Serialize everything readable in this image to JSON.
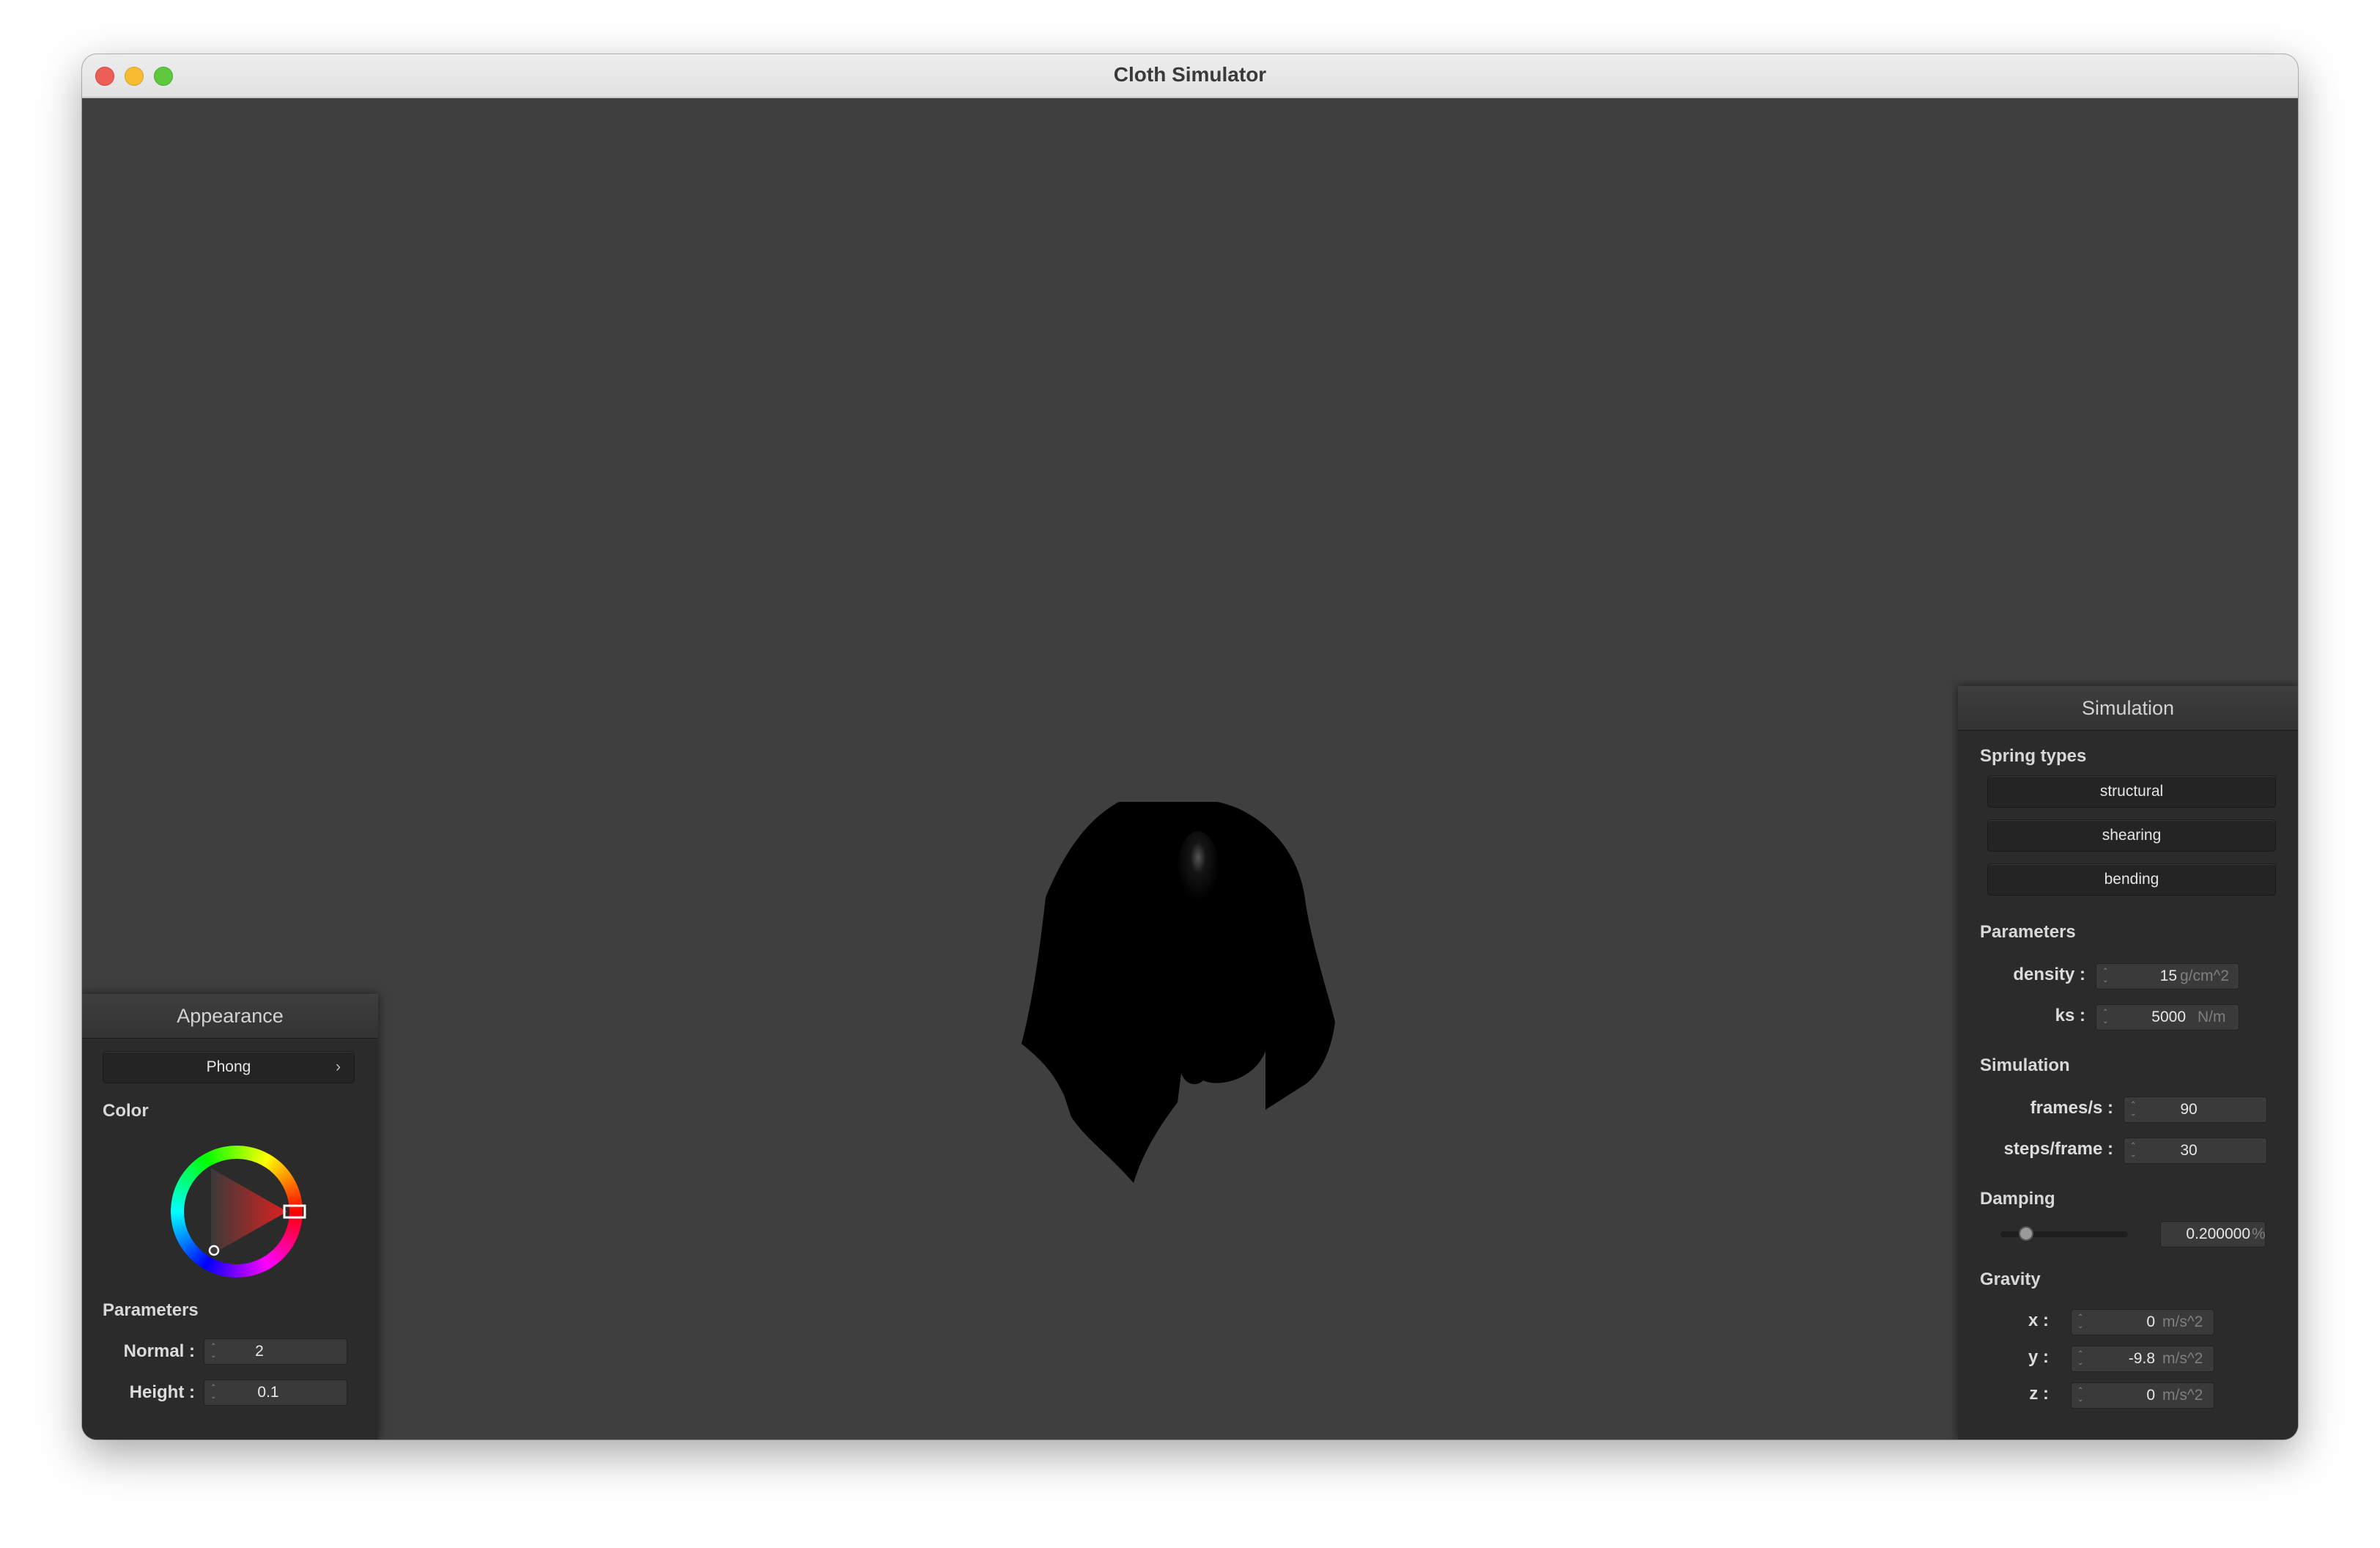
{
  "window": {
    "title": "Cloth Simulator"
  },
  "appearance": {
    "title": "Appearance",
    "shader": {
      "selected": "Phong",
      "chevron": "›"
    },
    "color_label": "Color",
    "selected_color": "#e02020",
    "parameters_label": "Parameters",
    "normal": {
      "label": "Normal :",
      "value": "2"
    },
    "height": {
      "label": "Height :",
      "value": "0.1"
    }
  },
  "simulation": {
    "title": "Simulation",
    "spring_types_label": "Spring types",
    "spring_buttons": [
      "structural",
      "shearing",
      "bending"
    ],
    "parameters_label": "Parameters",
    "density": {
      "label": "density :",
      "value": "15",
      "unit": "g/cm^2"
    },
    "ks": {
      "label": "ks :",
      "value": "5000",
      "unit": "N/m"
    },
    "simulation_label": "Simulation",
    "frames_per_s": {
      "label": "frames/s :",
      "value": "90"
    },
    "steps_per_frame": {
      "label": "steps/frame :",
      "value": "30"
    },
    "damping_label": "Damping",
    "damping": {
      "value": "0.200000",
      "unit": "%",
      "slider_fraction": 0.2
    },
    "gravity_label": "Gravity",
    "gravity_x": {
      "label": "x :",
      "value": "0",
      "unit": "m/s^2"
    },
    "gravity_y": {
      "label": "y :",
      "value": "-9.8",
      "unit": "m/s^2"
    },
    "gravity_z": {
      "label": "z :",
      "value": "0",
      "unit": "m/s^2"
    }
  },
  "icons": {
    "spinner": "updown-spinner-icon",
    "chevron": "chevron-right-icon"
  },
  "colors": {
    "viewport_bg": "#3f3f3f",
    "panel_bg": "#2b2b2b",
    "cloth": "#000000"
  }
}
